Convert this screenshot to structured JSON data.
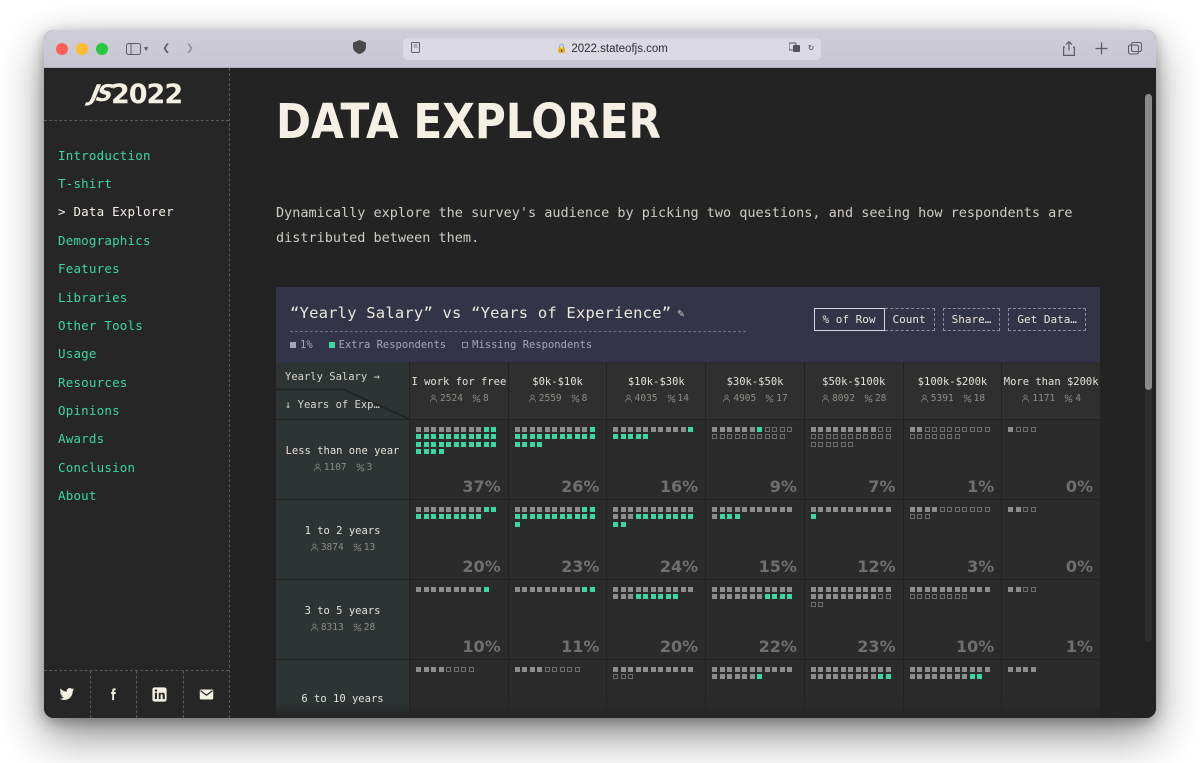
{
  "browser": {
    "url": "2022.stateofjs.com",
    "lock_icon": "lock-icon",
    "shield_icon": "shield-icon",
    "reader_icon": "reader-mode-icon",
    "extensions_icon": "extensions-icon",
    "reload_icon": "reload-icon",
    "share_icon": "share-icon",
    "newtab_icon": "new-tab-icon",
    "tabs_icon": "tab-overview-icon",
    "sidebar_icon": "sidebar-toggle-icon",
    "back_icon": "back-arrow-icon",
    "forward_icon": "forward-arrow-icon"
  },
  "sidebar": {
    "logo": "2022",
    "logo_mark": "JS",
    "items": [
      {
        "label": "Introduction",
        "active": false
      },
      {
        "label": "T-shirt",
        "active": false
      },
      {
        "label": "> Data Explorer",
        "active": true
      },
      {
        "label": "Demographics",
        "active": false
      },
      {
        "label": "Features",
        "active": false
      },
      {
        "label": "Libraries",
        "active": false
      },
      {
        "label": "Other Tools",
        "active": false
      },
      {
        "label": "Usage",
        "active": false
      },
      {
        "label": "Resources",
        "active": false
      },
      {
        "label": "Opinions",
        "active": false
      },
      {
        "label": "Awards",
        "active": false
      },
      {
        "label": "Conclusion",
        "active": false
      },
      {
        "label": "About",
        "active": false
      }
    ],
    "social": [
      "twitter-icon",
      "facebook-icon",
      "linkedin-icon",
      "email-icon"
    ]
  },
  "main": {
    "title": "DATA EXPLORER",
    "intro": "Dynamically explore the survey's audience by picking two questions, and seeing how respondents are distributed between them."
  },
  "explorer": {
    "title": "“Yearly Salary” vs “Years of Experience”",
    "edit_icon": "pencil-icon",
    "legend": [
      {
        "label": "1%",
        "style": "solid"
      },
      {
        "label": "Extra Respondents",
        "style": "teal"
      },
      {
        "label": "Missing Respondents",
        "style": "hollow"
      }
    ],
    "buttons": [
      {
        "label": "% of Row",
        "active": true
      },
      {
        "label": "Count",
        "active": false
      },
      {
        "label": "Share…",
        "active": false
      },
      {
        "label": "Get Data…",
        "active": false
      }
    ],
    "corner": {
      "top": "Yearly Salary →",
      "bottom": "↓ Years of Exp…"
    }
  },
  "colors": {
    "accent_teal": "#3ad6a4",
    "cream": "#f4f0e4",
    "page_bg": "#232323",
    "sidebar_bg": "#262626",
    "header_bg": "#343448",
    "cell_bg": "#2b2b2b",
    "label_bg": "#2e3434",
    "dot_grey": "#8d8d8d"
  },
  "chart_data": {
    "type": "heatmap",
    "title": "“Yearly Salary” vs “Years of Experience”",
    "mode": "% of Row",
    "xlabel": "Yearly Salary",
    "ylabel": "Years of Experience",
    "legend": [
      "1%",
      "Extra Respondents",
      "Missing Respondents"
    ],
    "columns": [
      {
        "label": "I work for free",
        "count": 2524,
        "percentage": 8
      },
      {
        "label": "$0k-$10k",
        "count": 2559,
        "percentage": 8
      },
      {
        "label": "$10k-$30k",
        "count": 4035,
        "percentage": 14
      },
      {
        "label": "$30k-$50k",
        "count": 4905,
        "percentage": 17
      },
      {
        "label": "$50k-$100k",
        "count": 8092,
        "percentage": 28
      },
      {
        "label": "$100k-$200k",
        "count": 5391,
        "percentage": 18
      },
      {
        "label": "More than $200k",
        "count": 1171,
        "percentage": 4
      }
    ],
    "rows": [
      {
        "label": "Less than one year",
        "count": 1107,
        "percentage": 3,
        "cells": [
          {
            "percent": 37,
            "grey": 9,
            "teal": 28,
            "hollow": 0
          },
          {
            "percent": 26,
            "grey": 10,
            "teal": 16,
            "hollow": 0
          },
          {
            "percent": 16,
            "grey": 10,
            "teal": 6,
            "hollow": 0
          },
          {
            "percent": 9,
            "grey": 6,
            "teal": 1,
            "hollow": 14
          },
          {
            "percent": 7,
            "grey": 9,
            "teal": 0,
            "hollow": 19
          },
          {
            "percent": 1,
            "grey": 2,
            "teal": 0,
            "hollow": 16
          },
          {
            "percent": 0,
            "grey": 1,
            "teal": 0,
            "hollow": 3
          }
        ]
      },
      {
        "label": "1 to 2 years",
        "count": 3874,
        "percentage": 13,
        "cells": [
          {
            "percent": 20,
            "grey": 9,
            "teal": 11,
            "hollow": 0
          },
          {
            "percent": 23,
            "grey": 9,
            "teal": 14,
            "hollow": 0
          },
          {
            "percent": 24,
            "grey": 14,
            "teal": 10,
            "hollow": 0
          },
          {
            "percent": 15,
            "grey": 12,
            "teal": 3,
            "hollow": 0
          },
          {
            "percent": 12,
            "grey": 11,
            "teal": 1,
            "hollow": 0
          },
          {
            "percent": 3,
            "grey": 4,
            "teal": 0,
            "hollow": 10
          },
          {
            "percent": 0,
            "grey": 2,
            "teal": 0,
            "hollow": 2
          }
        ]
      },
      {
        "label": "3 to 5 years",
        "count": 8313,
        "percentage": 28,
        "cells": [
          {
            "percent": 10,
            "grey": 9,
            "teal": 1,
            "hollow": 0
          },
          {
            "percent": 11,
            "grey": 9,
            "teal": 2,
            "hollow": 0
          },
          {
            "percent": 20,
            "grey": 14,
            "teal": 6,
            "hollow": 0
          },
          {
            "percent": 22,
            "grey": 18,
            "teal": 4,
            "hollow": 0
          },
          {
            "percent": 23,
            "grey": 20,
            "teal": 0,
            "hollow": 4
          },
          {
            "percent": 10,
            "grey": 11,
            "teal": 0,
            "hollow": 8
          },
          {
            "percent": 1,
            "grey": 2,
            "teal": 0,
            "hollow": 2
          }
        ]
      },
      {
        "label": "6 to 10 years",
        "count": null,
        "percentage": null,
        "cells": [
          {
            "percent": null,
            "grey": 4,
            "teal": 0,
            "hollow": 4
          },
          {
            "percent": null,
            "grey": 4,
            "teal": 0,
            "hollow": 5
          },
          {
            "percent": null,
            "grey": 11,
            "teal": 0,
            "hollow": 3
          },
          {
            "percent": null,
            "grey": 17,
            "teal": 1,
            "hollow": 0
          },
          {
            "percent": null,
            "grey": 20,
            "teal": 2,
            "hollow": 0
          },
          {
            "percent": null,
            "grey": 19,
            "teal": 2,
            "hollow": 0
          },
          {
            "percent": null,
            "grey": 4,
            "teal": 0,
            "hollow": 0
          }
        ]
      }
    ]
  }
}
